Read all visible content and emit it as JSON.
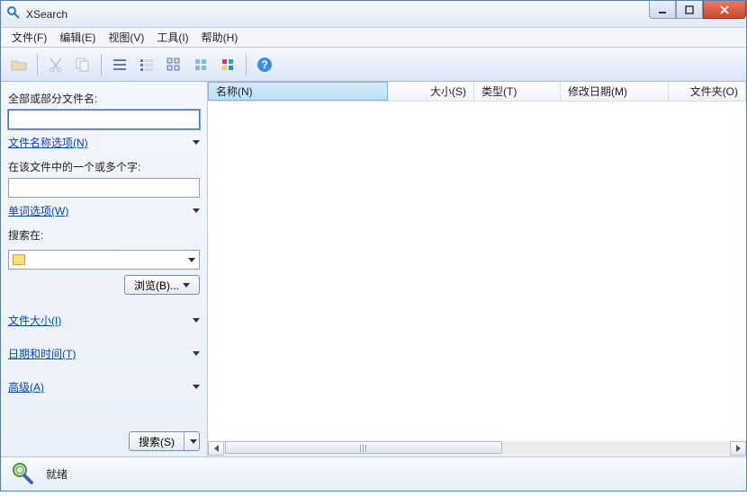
{
  "window": {
    "title": "XSearch"
  },
  "menu": {
    "file": "文件(F)",
    "edit": "编辑(E)",
    "view": "视图(V)",
    "tools": "工具(I)",
    "help": "帮助(H)"
  },
  "sidebar": {
    "filename_label": "全部或部分文件名:",
    "filename_value": "",
    "filename_options": "文件名称选项(N)",
    "content_label": "在该文件中的一个或多个字:",
    "content_value": "",
    "word_options": "单词选项(W)",
    "search_in_label": "搜索在:",
    "search_in_value": "",
    "browse_btn": "浏览(B)...",
    "filesize": "文件大小(I)",
    "datetime": "日期和时间(T)",
    "advanced": "高级(A)",
    "search_btn": "搜索(S)"
  },
  "columns": {
    "name": "名称(N)",
    "size": "大小(S)",
    "type": "类型(T)",
    "date": "修改日期(M)",
    "folder": "文件夹(O)"
  },
  "status": {
    "text": "就绪"
  }
}
